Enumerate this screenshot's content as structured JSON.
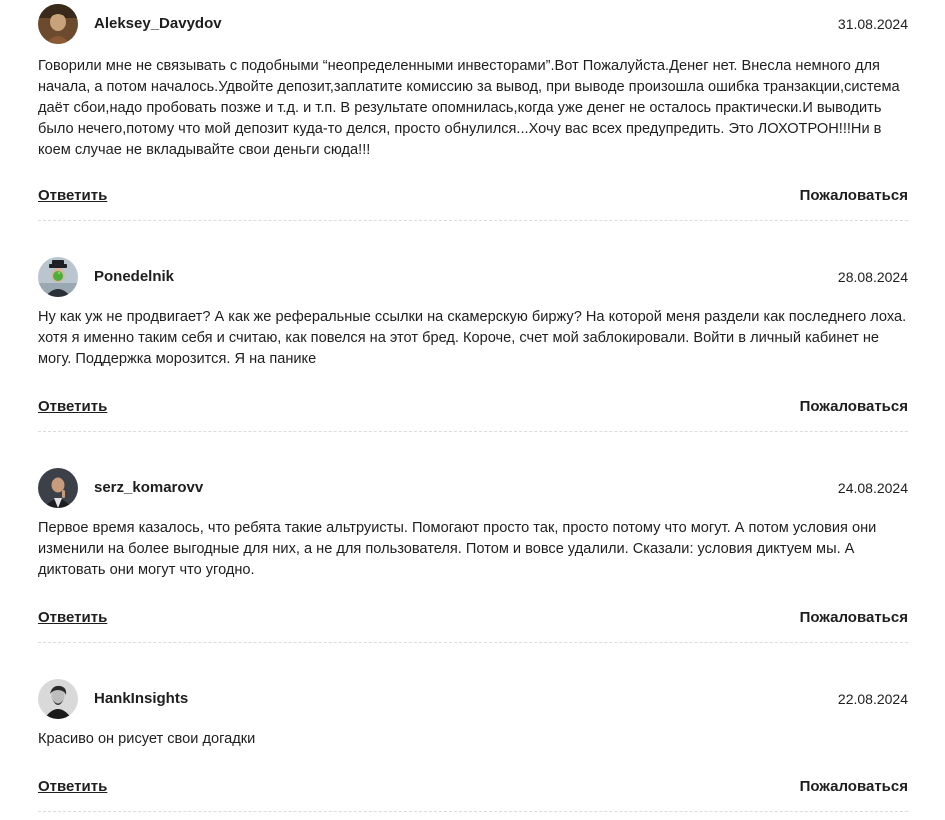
{
  "actions": {
    "reply_label": "Ответить",
    "report_label": "Пожаловаться"
  },
  "comments": [
    {
      "author": "Aleksey_Davydov",
      "date": "31.08.2024",
      "avatar_icon": "user-photo-icon",
      "text": "Говорили мне не связывать с подобными “неопределенными инвесторами”.Вот Пожалуйста.Денег нет. Внесла немного для начала, а потом началось.Удвойте депозит,заплатите комиссию за вывод, при выводе произошла ошибка транзакции,система даёт сбои,надо пробовать позже и т.д. и т.п. В результате опомнилась,когда уже денег не осталось практически.И выводить было нечего,потому что мой депозит куда-то делся, просто обнулился...Хочу вас всех предупредить. Это ЛОХОТРОН!!!Ни в коем случае не вкладывайте свои деньги сюда!!!"
    },
    {
      "author": "Ponedelnik",
      "date": "28.08.2024",
      "avatar_icon": "user-photo-icon",
      "text": "Ну как уж не продвигает? А как же реферальные ссылки на скамерскую биржу? На которой меня раздели как последнего лоха. хотя я именно таким себя и считаю, как повелся на этот бред. Короче, счет мой заблокировали. Войти в личный кабинет не могу. Поддержка морозится. Я на панике"
    },
    {
      "author": "serz_komarovv",
      "date": "24.08.2024",
      "avatar_icon": "user-photo-icon",
      "text": "Первое время казалось, что ребята такие альтруисты. Помогают просто так, просто потому что могут. А потом условия они изменили на более выгодные для них, а не для пользователя. Потом и вовсе удалили. Сказали: условия диктуем мы. А диктовать они могут что угодно."
    },
    {
      "author": "HankInsights",
      "date": "22.08.2024",
      "avatar_icon": "user-photo-icon",
      "text": "Красиво он рисует свои догадки"
    }
  ]
}
